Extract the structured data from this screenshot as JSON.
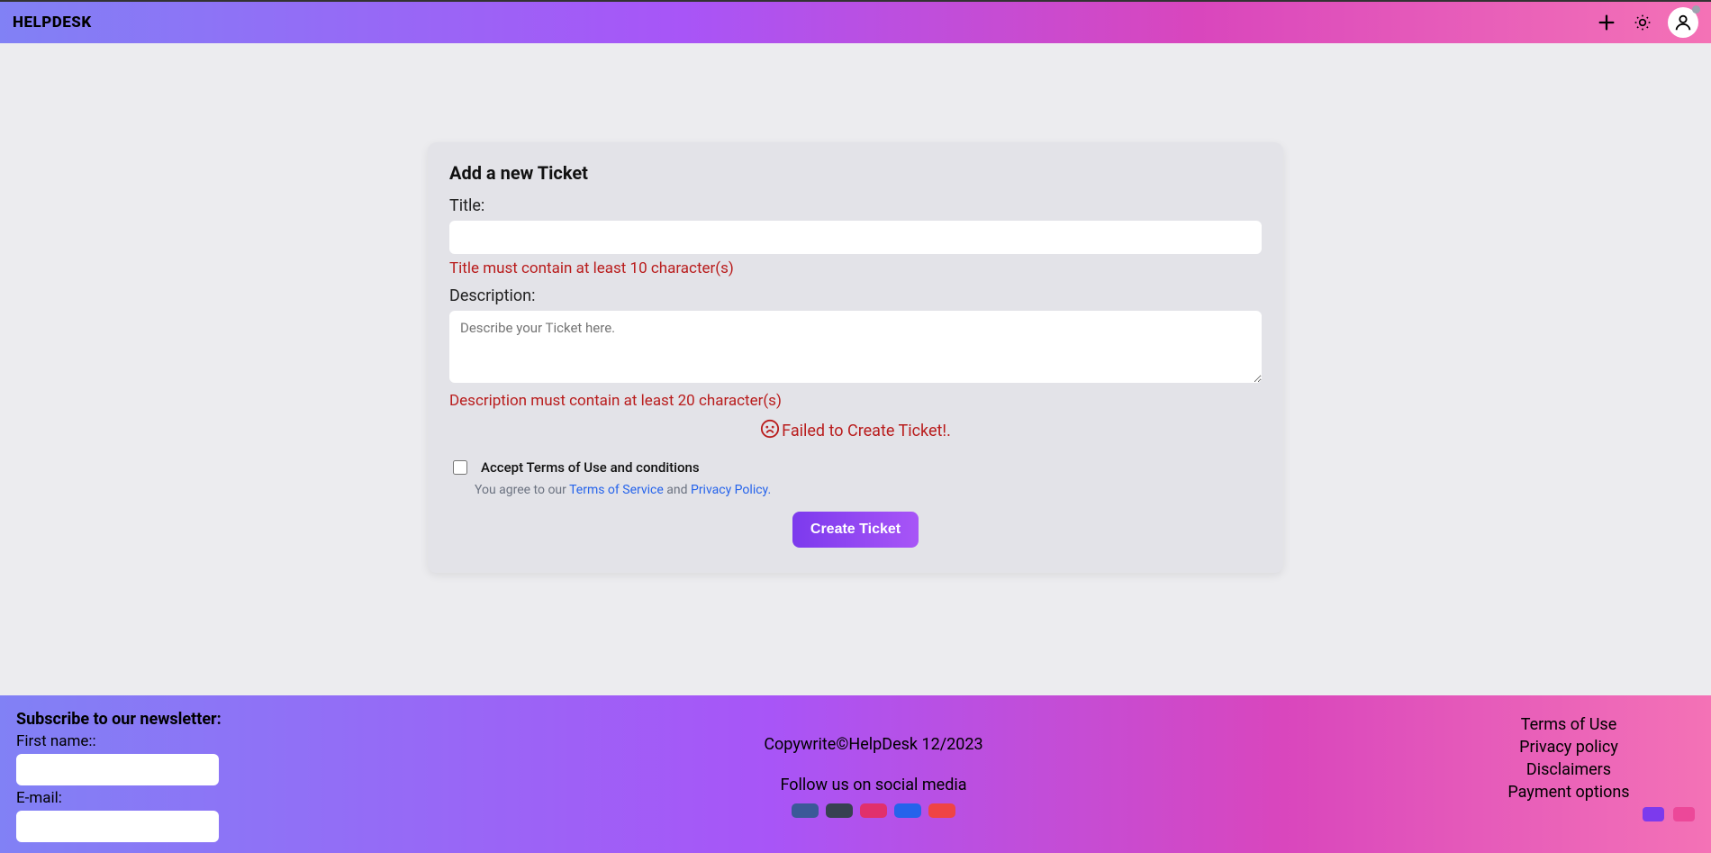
{
  "header": {
    "brand": "HELPDESK"
  },
  "form": {
    "title": "Add a new Ticket",
    "title_label": "Title:",
    "title_value": "",
    "title_error": "Title must contain at least 10 character(s)",
    "desc_label": "Description:",
    "desc_placeholder": "Describe your Ticket here.",
    "desc_value": "",
    "desc_error": "Description must contain at least 20 character(s)",
    "fail_message": "Failed to Create Ticket!.",
    "terms_main": "Accept Terms of Use and conditions",
    "terms_prefix": "You agree to our ",
    "terms_tos": "Terms of Service",
    "terms_mid": " and ",
    "terms_pp": "Privacy Policy.",
    "submit_label": "Create Ticket"
  },
  "footer": {
    "newsletter_heading": "Subscribe to our newsletter:",
    "first_name_label": "First name::",
    "email_label": "E-mail:",
    "copywrite": "Copywrite©HelpDesk 12/2023",
    "follow": "Follow us on social media",
    "links": {
      "tou": "Terms of Use",
      "privacy": "Privacy policy",
      "disclaimers": "Disclaimers",
      "payment": "Payment options"
    }
  }
}
